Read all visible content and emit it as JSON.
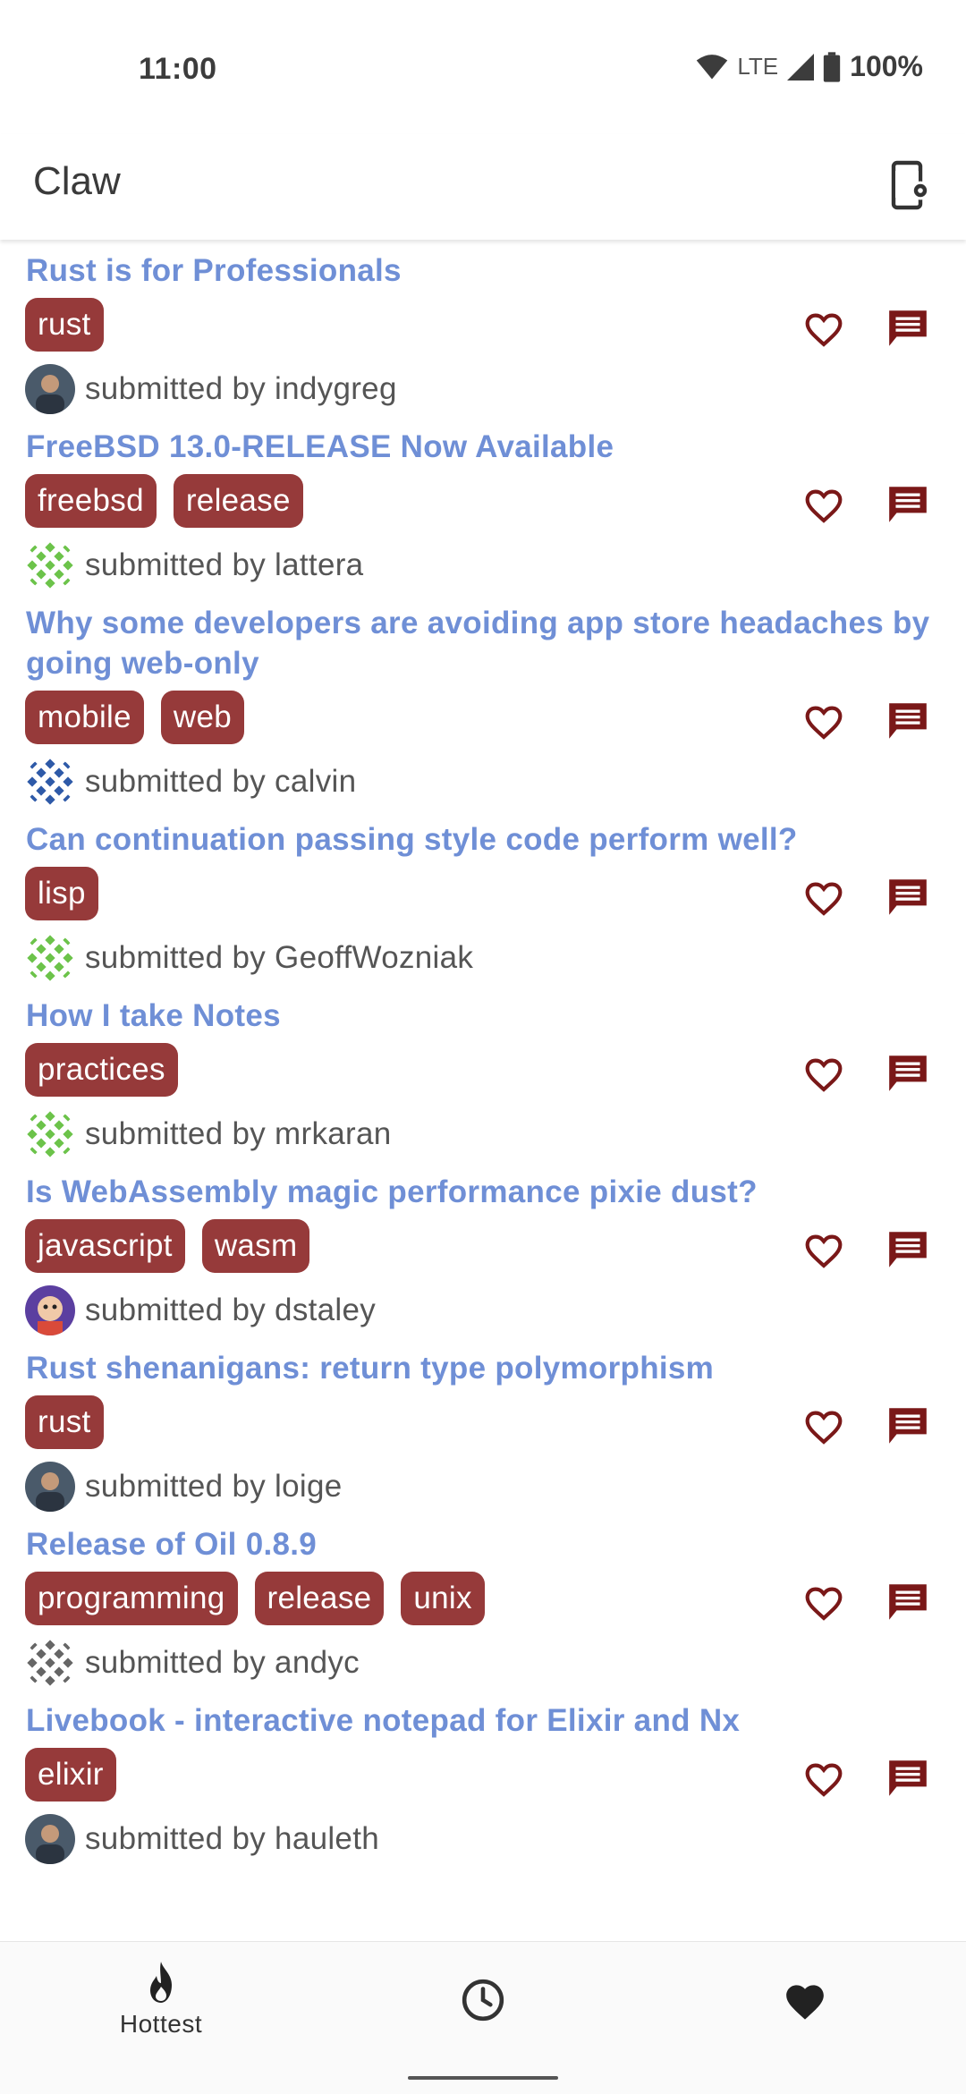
{
  "status": {
    "time": "11:00",
    "network": "LTE",
    "battery": "100%"
  },
  "app": {
    "title": "Claw"
  },
  "stories": [
    {
      "title": "Rust is for Professionals",
      "tags": [
        "rust"
      ],
      "submitted": "submitted by indygreg",
      "avatar": "avatar-photo"
    },
    {
      "title": "FreeBSD 13.0-RELEASE Now Available",
      "tags": [
        "freebsd",
        "release"
      ],
      "submitted": "submitted by lattera",
      "avatar": "avatar-identicon-green"
    },
    {
      "title": "Why some developers are avoiding app store headaches by going web-only",
      "tags": [
        "mobile",
        "web"
      ],
      "submitted": "submitted by calvin",
      "avatar": "avatar-identicon-blue"
    },
    {
      "title": "Can continuation passing style code perform well?",
      "tags": [
        "lisp"
      ],
      "submitted": "submitted by GeoffWozniak",
      "avatar": "avatar-identicon-green"
    },
    {
      "title": "How I take Notes",
      "tags": [
        "practices"
      ],
      "submitted": "submitted by mrkaran",
      "avatar": "avatar-identicon-green"
    },
    {
      "title": "Is WebAssembly magic performance pixie dust?",
      "tags": [
        "javascript",
        "wasm"
      ],
      "submitted": "submitted by dstaley",
      "avatar": "avatar-illustration"
    },
    {
      "title": "Rust shenanigans: return type polymorphism",
      "tags": [
        "rust"
      ],
      "submitted": "submitted by loige",
      "avatar": "avatar-photo"
    },
    {
      "title": "Release of Oil 0.8.9",
      "tags": [
        "programming",
        "release",
        "unix"
      ],
      "submitted": "submitted by andyc",
      "avatar": "avatar-identicon-gray"
    },
    {
      "title": "Livebook - interactive notepad for Elixir and Nx",
      "tags": [
        "elixir"
      ],
      "submitted": "submitted by hauleth",
      "avatar": "avatar-photo"
    }
  ],
  "nav": {
    "hottest_label": "Hottest"
  },
  "colors": {
    "accent": "#963a3a",
    "title_link": "#6f8fd6",
    "icon": "#7a1818"
  }
}
